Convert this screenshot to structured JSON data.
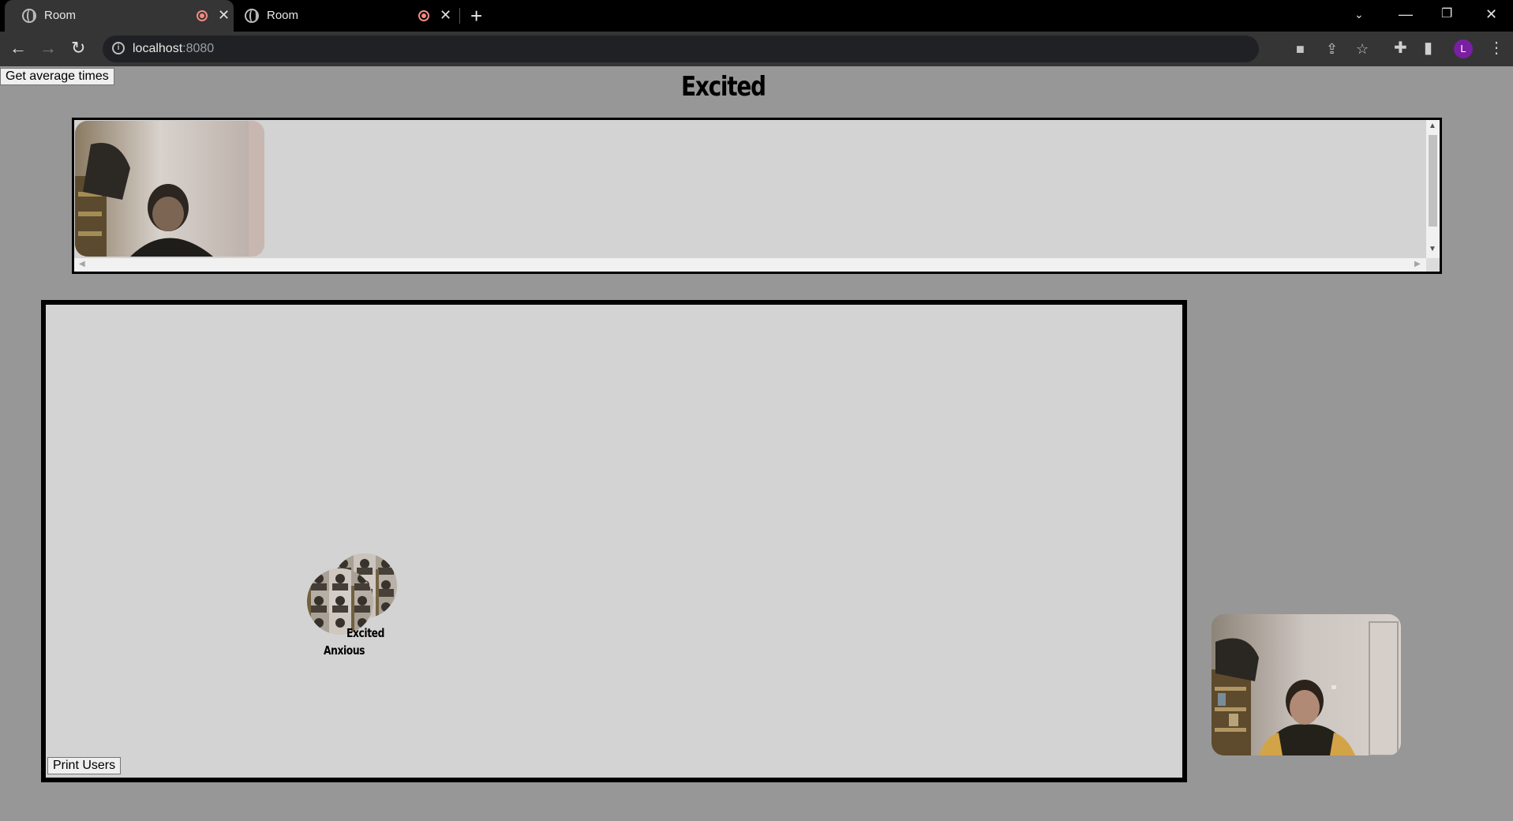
{
  "browser": {
    "tabs": [
      {
        "title": "Room",
        "recording": true,
        "active": true
      },
      {
        "title": "Room",
        "recording": true,
        "active": false
      }
    ],
    "url_host": "localhost",
    "url_port": ":8080",
    "profile_initial": "L"
  },
  "page": {
    "average_times_button": "Get average times",
    "current_emotion": "Excited",
    "print_users_button": "Print Users"
  },
  "users": [
    {
      "emotion": "Excited"
    },
    {
      "emotion": "Anxious"
    }
  ],
  "colors": {
    "page_background": "#979797",
    "panel_background": "#d3d3d3",
    "profile_avatar": "#7b1fa2",
    "recording_indicator": "#f28b82"
  }
}
